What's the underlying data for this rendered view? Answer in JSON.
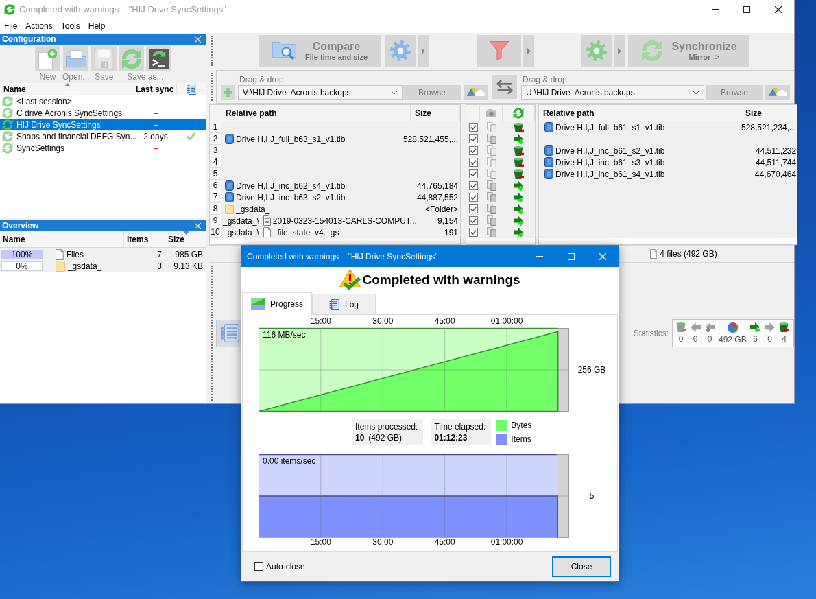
{
  "window": {
    "title": "Completed with warnings – \"HIJ Drive SyncSettings\"",
    "active": false
  },
  "menu": [
    "File",
    "Actions",
    "Tools",
    "Help"
  ],
  "configuration": {
    "title": "Configuration",
    "toolbar": [
      {
        "label": "New",
        "buttons": [
          {
            "kind": "new"
          }
        ]
      },
      {
        "label": "Open...",
        "buttons": [
          {
            "kind": "open"
          }
        ]
      },
      {
        "label": "Save",
        "buttons": [
          {
            "kind": "save"
          }
        ]
      },
      {
        "label": "Save as...",
        "buttons": [
          {
            "kind": "save_as"
          },
          {
            "kind": "save_as_batch"
          }
        ]
      }
    ],
    "columns": [
      {
        "label": "Name",
        "sorted": true,
        "descending": false
      },
      {
        "label": "Last sync",
        "sorted": false
      }
    ],
    "items": [
      {
        "name": "<Last session>",
        "selected": false,
        "synced_ok": false
      },
      {
        "name": "C drive Acronis SyncSettings",
        "last_sync": {
          "text": "–",
          "never": true
        },
        "selected": false,
        "synced_ok": false
      },
      {
        "name": "HIJ Drive SyncSettings",
        "last_sync": {
          "text": "–",
          "never": true
        },
        "selected": true,
        "synced_ok": false
      },
      {
        "name": "Snaps and financial DEFG Syn...",
        "last_sync": {
          "text": "2 days",
          "never": false
        },
        "selected": false,
        "synced_ok": true
      },
      {
        "name": "SyncSettings",
        "last_sync": {
          "text": "–",
          "never": true
        },
        "selected": false,
        "synced_ok": false
      }
    ]
  },
  "overview": {
    "title": "Overview",
    "columns": [
      {
        "label": "Name",
        "sorted": false
      },
      {
        "label": "Items",
        "sorted": false
      },
      {
        "label": "Size",
        "sorted": true,
        "descending": true
      }
    ],
    "rows": [
      {
        "share": "100%",
        "level": 1,
        "kind": "files",
        "name": "Files",
        "items": "7",
        "size": "985 GB"
      },
      {
        "share": "0%",
        "level": 0,
        "kind": "folder",
        "name": "_gsdata_",
        "items": "3",
        "size": "9.13 KB"
      }
    ]
  },
  "toolbar": {
    "compare": {
      "label": "Compare",
      "variant": "File time and size"
    },
    "synchronize": {
      "label": "Synchronize",
      "variant": "Mirror ->"
    }
  },
  "folder_pairs": [
    {
      "hint": "Drag & drop",
      "path": "V:\\HIJ Drive  Acronis backups",
      "browse": "Browse"
    },
    {
      "hint": "Drag & drop",
      "path": "U:\\HIJ Drive  Acronis backups",
      "browse": "Browse"
    }
  ],
  "grid": {
    "left_columns": [
      "Relative path",
      "Size"
    ],
    "right_columns": [
      "Relative path",
      "Size"
    ],
    "rows": [
      {
        "number": "1",
        "checked": true,
        "kind": "delete",
        "right": {
          "kind": "image",
          "name": "Drive H,I,J_full_b61_s1_v1.tib",
          "size": "528,521,234,..."
        }
      },
      {
        "number": "2",
        "left": {
          "kind": "image",
          "name": "Drive H,I,J_full_b63_s1_v1.tib",
          "size": "528,521,455,..."
        },
        "checked": true,
        "kind": "create"
      },
      {
        "number": "3",
        "checked": true,
        "kind": "delete",
        "right": {
          "kind": "image",
          "name": "Drive H,I,J_inc_b61_s2_v1.tib",
          "size": "44,511,232"
        }
      },
      {
        "number": "4",
        "checked": true,
        "kind": "delete",
        "right": {
          "kind": "image",
          "name": "Drive H,I,J_inc_b61_s3_v1.tib",
          "size": "44,511,744"
        }
      },
      {
        "number": "5",
        "checked": true,
        "kind": "delete",
        "right": {
          "kind": "image",
          "name": "Drive H,I,J_inc_b61_s4_v1.tib",
          "size": "44,670,464"
        }
      },
      {
        "number": "6",
        "left": {
          "kind": "image",
          "name": "Drive H,I,J_inc_b62_s4_v1.tib",
          "size": "44,765,184"
        },
        "checked": true,
        "kind": "create"
      },
      {
        "number": "7",
        "left": {
          "kind": "image",
          "name": "Drive H,I,J_inc_b63_s2_v1.tib",
          "size": "44,887,552"
        },
        "checked": true,
        "kind": "create"
      },
      {
        "number": "8",
        "left": {
          "kind": "folder",
          "name": "_gsdata_",
          "size": "<Folder>"
        },
        "checked": true,
        "kind": "create"
      },
      {
        "number": "9",
        "left": {
          "folder": "_gsdata_\\",
          "kind": "text",
          "name": "2019-0323-154013-CARLS-COMPUT...",
          "size": "9,154"
        },
        "checked": true,
        "kind": "create"
      },
      {
        "number": "10",
        "left": {
          "folder": "_gsdata_\\",
          "kind": "file",
          "name": "_file_state_v4._gs",
          "size": "191"
        },
        "checked": true,
        "kind": "create"
      }
    ]
  },
  "status": {
    "summary": "4 files (492 GB)"
  },
  "statistics": {
    "label": "Statistics:",
    "items": [
      {
        "kind": "delete_left",
        "value": "0"
      },
      {
        "kind": "update_left",
        "value": "0"
      },
      {
        "kind": "create_left",
        "value": "0"
      },
      {
        "kind": "data",
        "value": "492 GB"
      },
      {
        "kind": "create_right",
        "value": "6"
      },
      {
        "kind": "update_right",
        "value": "0"
      },
      {
        "kind": "delete_right",
        "value": "4"
      }
    ]
  },
  "dialog": {
    "title": "Completed with warnings – \"HIJ Drive SyncSettings\"",
    "active": true,
    "heading": "Completed with warnings",
    "tabs": [
      {
        "label": "Progress",
        "kind": "progress",
        "selected": true
      },
      {
        "label": "Log",
        "kind": "log",
        "selected": false
      }
    ],
    "bytes_graph": {
      "chart_data": {
        "type": "area",
        "x": [
          0,
          72.38
        ],
        "series": [
          {
            "color": "#70ff66",
            "values": [
              0,
              492
            ]
          }
        ],
        "xlim": [
          0,
          75
        ],
        "ylim": [
          0,
          512
        ],
        "xticks": [
          {
            "value": 15,
            "label": "15:00"
          },
          {
            "value": 30,
            "label": "30:00"
          },
          {
            "value": 45,
            "label": "45:00"
          },
          {
            "value": 60,
            "label": "01:00:00"
          }
        ],
        "yticks": [
          {
            "value": 256,
            "label": "256 GB"
          }
        ],
        "grid": true,
        "annotations": [
          {
            "text": "116 MB/sec"
          }
        ]
      }
    },
    "items_processed": {
      "label": "Items processed:",
      "value": "10",
      "detail": "(492 GB)"
    },
    "time_elapsed": {
      "label": "Time elapsed:",
      "value": "01:12:23"
    },
    "legend": [
      {
        "label": "Bytes",
        "color": "#70ff66"
      },
      {
        "label": "Items",
        "color": "#7f90ff"
      }
    ],
    "items_graph": {
      "rate": "0.00 items/sec",
      "scale": "5",
      "time_labels": [
        "15:00",
        "30:00",
        "45:00",
        "01:00:00"
      ]
    },
    "auto_close": {
      "label": "Auto-close",
      "checked": false
    },
    "close_button": "Close"
  }
}
